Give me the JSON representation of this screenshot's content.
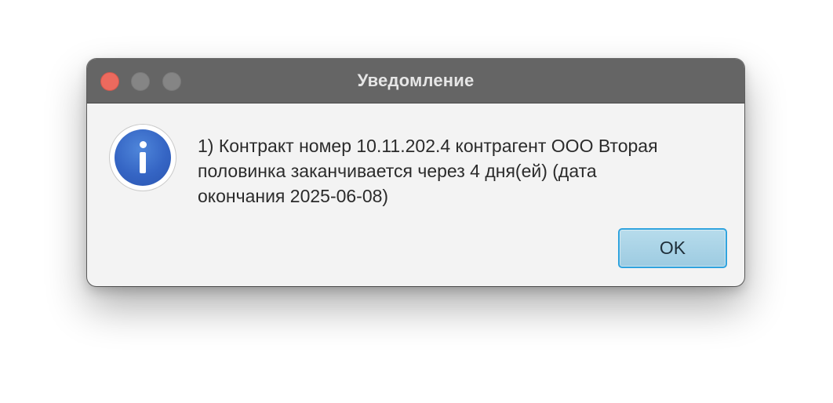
{
  "window": {
    "title": "Уведомление",
    "controls": {
      "close_color": "#ec6a5e",
      "minimize_color": "#858585",
      "maximize_color": "#858585"
    }
  },
  "dialog": {
    "icon": "info-icon",
    "icon_color": "#3565c4",
    "message_lines": [
      "1) Контракт номер 10.11.202.4 контрагент ООО Вторая",
      "половинка заканчивается через 4 дня(ей) (дата",
      "окончания 2025-06-08)"
    ],
    "ok_label": "OK"
  }
}
